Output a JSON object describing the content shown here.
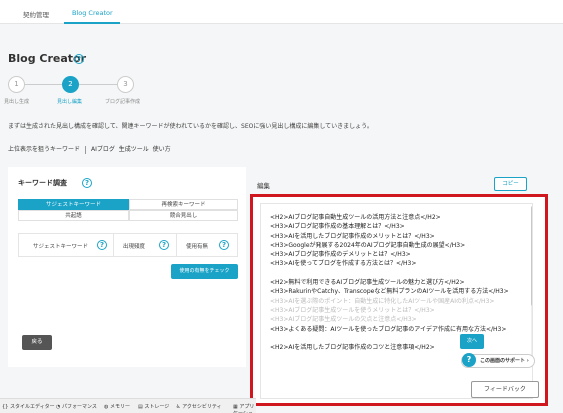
{
  "tabs": [
    {
      "label": "契約管理"
    },
    {
      "label": "Blog Creator"
    }
  ],
  "page": {
    "title": "Blog Creator",
    "description": "まずは生成された見出し構成を確認して、関連キーワードが使われているかを確認し、SEOに強い見出し構成に編集していきましょう。"
  },
  "steps": [
    {
      "number": "1",
      "label": "見出し生成"
    },
    {
      "number": "2",
      "label": "見出し編集"
    },
    {
      "number": "3",
      "label": "ブログ記事作成"
    }
  ],
  "keywords": {
    "label": "上位表示を狙うキーワード",
    "items": [
      "AIブログ",
      "生成ツール",
      "使い方"
    ]
  },
  "keyword_research": {
    "title": "キーワード調査",
    "segments": [
      "サジェストキーワード",
      "再検索キーワード",
      "共起語",
      "競合見出し"
    ],
    "columns": [
      "サジェストキーワード",
      "出現頻度",
      "使用有無"
    ],
    "check_button": "使用の有無をチェック",
    "back_button": "戻る"
  },
  "editor": {
    "label": "編集",
    "copy_button": "コピー",
    "lines": [
      "<H2>AIブログ記事自動生成ツールの活用方法と注意点</H2>",
      "<H3>AIブログ記事作成の基本理解とは？</H3>",
      "<H3>AIを活用したブログ記事作成のメリットとは？</H3>",
      "<H3>Googleが発展する2024年のAIブログ記事自動生成の展望</H3>",
      "<H3>AIブログ記事作成のデメリットとは？</H3>",
      "<H3>AIを使ってブログを作成する方法とは？</H3>",
      "",
      "<H2>無料で利用できるAIブログ記事生成ツールの魅力と選び方</H2>",
      "<H3>RakurinやCatchy、Transcopeなど無料プランのAIツールを活用する方法</H3>",
      "<H3>AIを選ぶ際のポイント：自動生成に特化したAIツールや国産AIの利点</H3>",
      "<H3>AIブログ記事生成ツールを使うメリットとは？</H3>",
      "<H3>AIブログ記事生成ツールの欠点と注意点</H3>",
      "<H3>よくある疑問：AIツールを使ったブログ記事のアイデア作成に有用な方法</H3>",
      "",
      "<H2>AIを活用したブログ記事作成のコツと注意事項</H2>"
    ]
  },
  "next_button": "次へ",
  "support_label": "この画面のサポート",
  "feedback_button": "フィードバック",
  "devtools": [
    "スタイルエディター",
    "パフォーマンス",
    "メモリー",
    "ストレージ",
    "アクセシビリティ",
    "アプリケーション"
  ]
}
